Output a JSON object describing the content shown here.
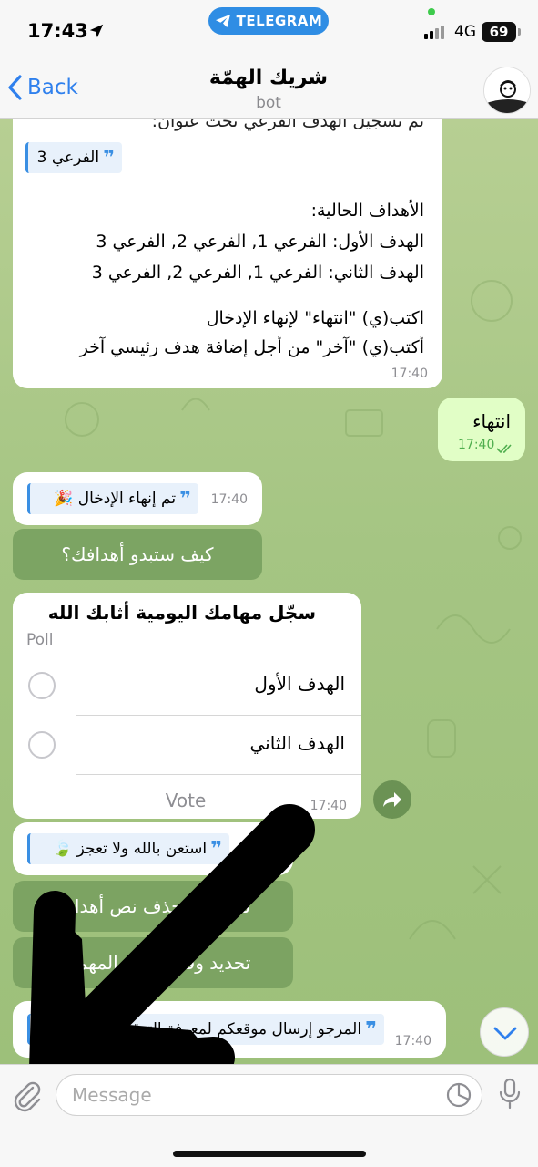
{
  "status_bar": {
    "time": "17:43",
    "app_pill": "TELEGRAM",
    "network": "4G",
    "battery": "69"
  },
  "header": {
    "back_label": "Back",
    "title": "شريك الهمّة",
    "subtitle": "bot"
  },
  "messages": {
    "m1": {
      "top_partial": "تم تسجيل الهدف الفرعي تحت عنوان:",
      "quote": "الفرعي 3",
      "lines": [
        "الأهداف الحالية:",
        "الهدف الأول: الفرعي 1, الفرعي 2, الفرعي 3",
        "الهدف الثاني: الفرعي 1, الفرعي 2, الفرعي 3",
        "اكتب(ي) \"انتهاء\" لإنهاء الإدخال",
        "أكتب(ي) \"آخر\" من أجل إضافة هدف رئيسي آخر"
      ],
      "time": "17:40"
    },
    "m2": {
      "text": "انتهاء",
      "time": "17:40"
    },
    "m3": {
      "quote": "تم إنهاء الإدخال 🎉",
      "time": "17:40"
    },
    "m3_button": "كيف ستبدو أهدافك؟",
    "poll": {
      "title": "سجّل مهامك اليومية أثابك الله",
      "type_label": "Poll",
      "options": [
        "الهدف الأول",
        "الهدف الثاني"
      ],
      "vote_label": "Vote",
      "time": "17:40"
    },
    "m5": {
      "quote": "استعن بالله ولا تعجز 🍃"
    },
    "m5_buttons": [
      "تعديل أو حذف نص أهداف",
      "تحديد وقت تذكير المهمات"
    ],
    "m6": {
      "quote": "المرجو إرسال موقعكم لمعرفة التوقيت المحلي",
      "time": "17:40"
    }
  },
  "input": {
    "placeholder": "Message"
  },
  "colors": {
    "accent": "#2f80ed",
    "outgoing_bubble": "#e1fec6",
    "incoming_bubble": "#ffffff",
    "telegram_pill": "#2f8de4"
  }
}
